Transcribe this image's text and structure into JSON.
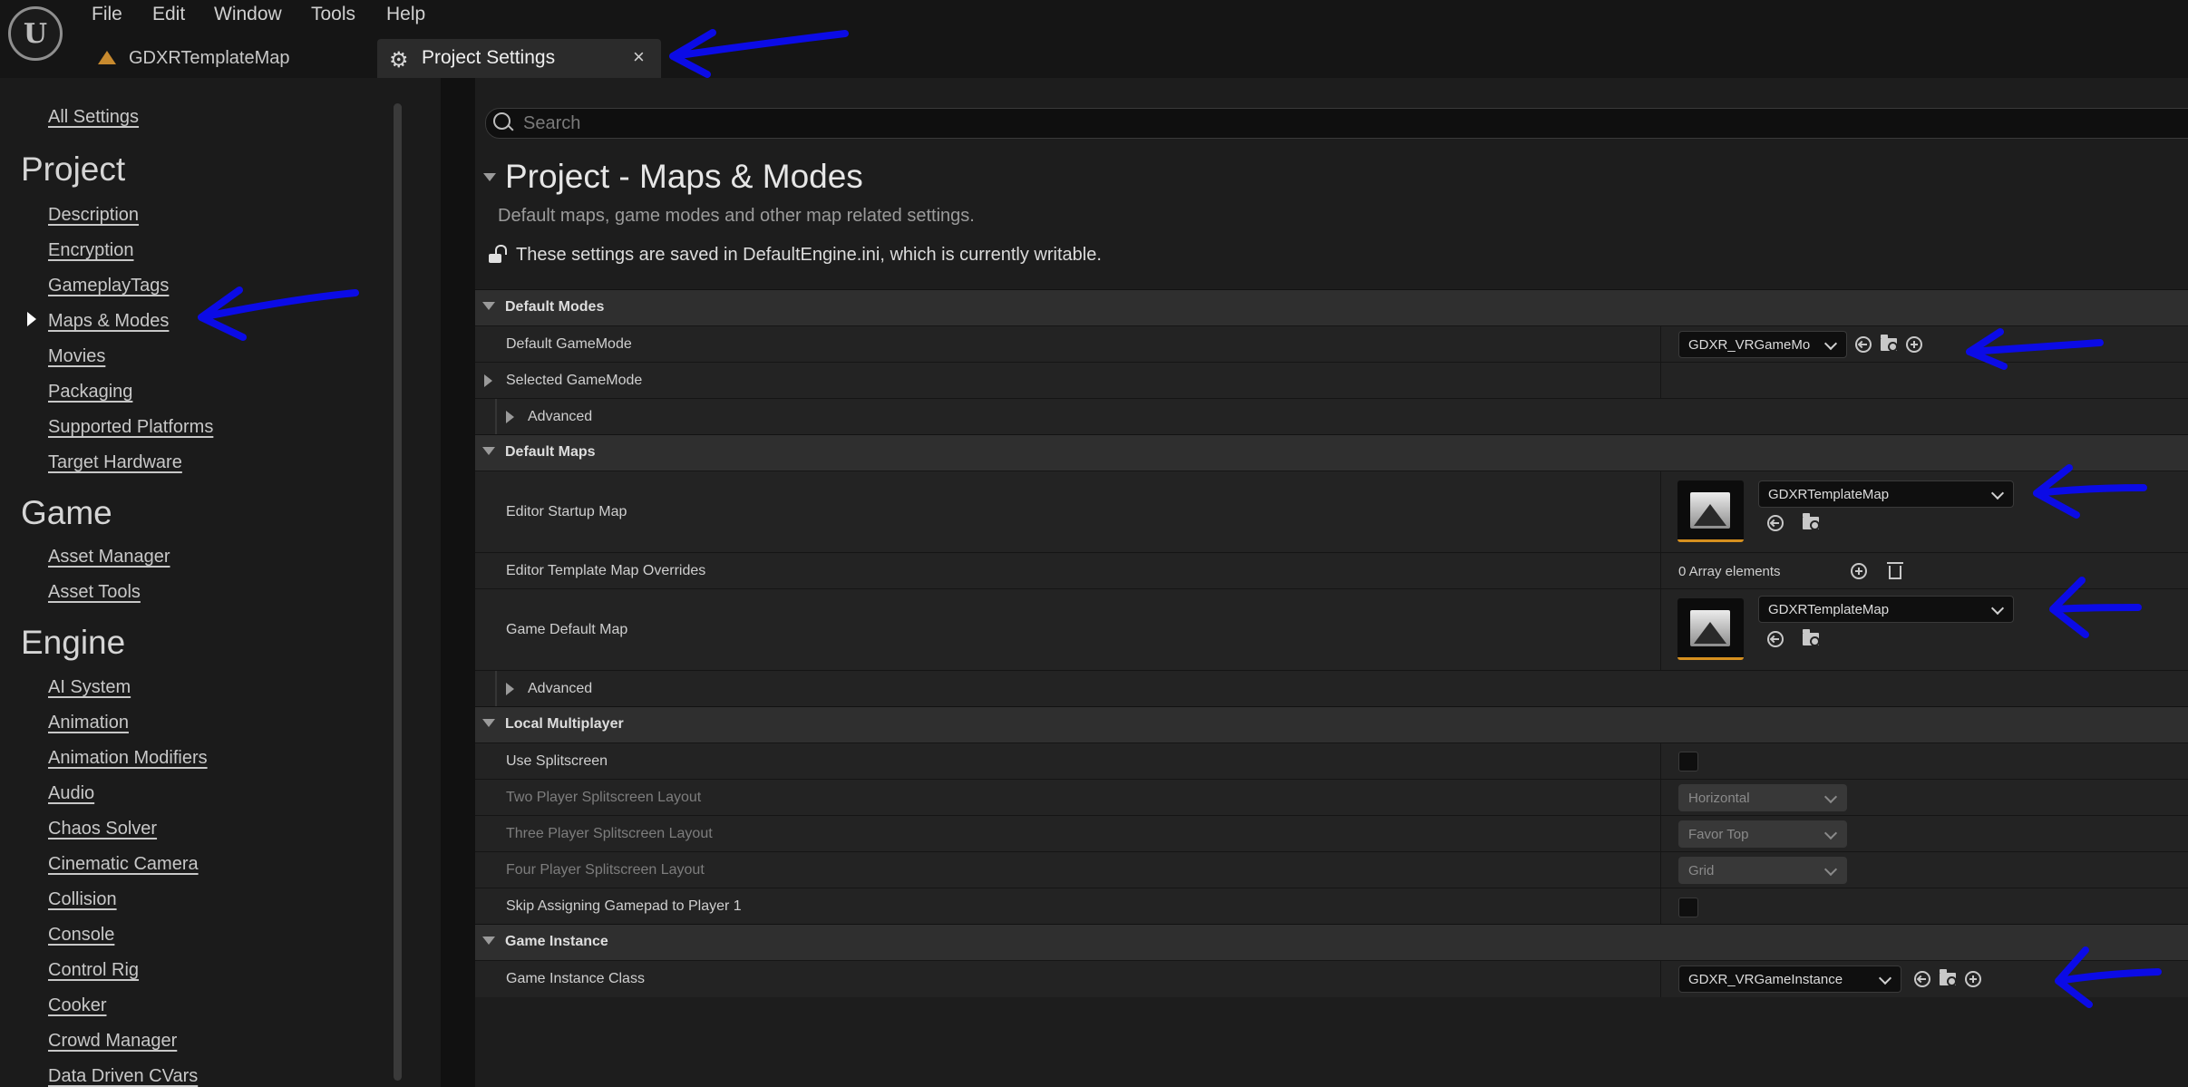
{
  "menu": [
    "File",
    "Edit",
    "Window",
    "Tools",
    "Help"
  ],
  "tabs": {
    "document": "GDXRTemplateMap",
    "settings": "Project Settings",
    "close_glyph": "×"
  },
  "sidebar": {
    "all_settings": "All Settings",
    "groups": [
      {
        "header": "Project",
        "items": [
          "Description",
          "Encryption",
          "GameplayTags",
          "Maps & Modes",
          "Movies",
          "Packaging",
          "Supported Platforms",
          "Target Hardware"
        ]
      },
      {
        "header": "Game",
        "items": [
          "Asset Manager",
          "Asset Tools"
        ]
      },
      {
        "header": "Engine",
        "items": [
          "AI System",
          "Animation",
          "Animation Modifiers",
          "Audio",
          "Chaos Solver",
          "Cinematic Camera",
          "Collision",
          "Console",
          "Control Rig",
          "Cooker",
          "Crowd Manager",
          "Data Driven CVars"
        ]
      }
    ],
    "selected": "Maps & Modes"
  },
  "search": {
    "placeholder": "Search"
  },
  "page": {
    "title": "Project - Maps & Modes",
    "description": "Default maps, game modes and other map related settings.",
    "writable_notice": "These settings are saved in DefaultEngine.ini, which is currently writable."
  },
  "sections": {
    "default_modes": {
      "title": "Default Modes",
      "default_gamemode_label": "Default GameMode",
      "default_gamemode_value": "GDXR_VRGameMo",
      "selected_gamemode_label": "Selected GameMode",
      "advanced_label": "Advanced"
    },
    "default_maps": {
      "title": "Default Maps",
      "editor_startup_label": "Editor Startup Map",
      "editor_startup_value": "GDXRTemplateMap",
      "template_overrides_label": "Editor Template Map Overrides",
      "template_overrides_value": "0 Array elements",
      "game_default_label": "Game Default Map",
      "game_default_value": "GDXRTemplateMap",
      "advanced_label": "Advanced"
    },
    "local_multiplayer": {
      "title": "Local Multiplayer",
      "use_splitscreen_label": "Use Splitscreen",
      "use_splitscreen_checked": false,
      "two_player_label": "Two Player Splitscreen Layout",
      "two_player_value": "Horizontal",
      "three_player_label": "Three Player Splitscreen Layout",
      "three_player_value": "Favor Top",
      "four_player_label": "Four Player Splitscreen Layout",
      "four_player_value": "Grid",
      "skip_gamepad_label": "Skip Assigning Gamepad to Player 1",
      "skip_gamepad_checked": false
    },
    "game_instance": {
      "title": "Game Instance",
      "class_label": "Game Instance Class",
      "class_value": "GDXR_VRGameInstance"
    }
  },
  "colors": {
    "annotation_arrow": "#0b0be6",
    "thumbnail_accent": "#d6901f",
    "map_icon": "#c88a2e"
  }
}
